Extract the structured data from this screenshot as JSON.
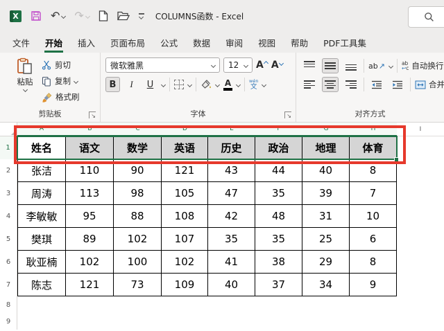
{
  "titlebar": {
    "title": "COLUMNS函数 - Excel"
  },
  "icons": {
    "excel_logo": "X",
    "undo": "↶",
    "redo": "↷",
    "launcher": "↘",
    "grow_font": "A",
    "shrink_font": "A",
    "bold": "B",
    "italic": "I",
    "underline": "U",
    "font_color": "A",
    "phonetic_top": "wén",
    "phonetic_bottom": "文",
    "orientation_ab": "ab",
    "orientation_arrow": "↗",
    "wrap_ab": "ab",
    "wrap_c": "c",
    "wrap_arrow": "↩"
  },
  "tabs": [
    {
      "name": "file",
      "label": "文件",
      "active": false
    },
    {
      "name": "home",
      "label": "开始",
      "active": true
    },
    {
      "name": "insert",
      "label": "插入",
      "active": false
    },
    {
      "name": "page-layout",
      "label": "页面布局",
      "active": false
    },
    {
      "name": "formulas",
      "label": "公式",
      "active": false
    },
    {
      "name": "data",
      "label": "数据",
      "active": false
    },
    {
      "name": "review",
      "label": "审阅",
      "active": false
    },
    {
      "name": "view",
      "label": "视图",
      "active": false
    },
    {
      "name": "help",
      "label": "帮助",
      "active": false
    },
    {
      "name": "pdf-tools",
      "label": "PDF工具集",
      "active": false
    }
  ],
  "ribbon": {
    "clipboard": {
      "label": "剪贴板",
      "paste": "粘贴",
      "cut": "剪切",
      "copy": "复制",
      "format_painter": "格式刷"
    },
    "font": {
      "label": "字体",
      "font_name": "微软雅黑",
      "font_size": "12"
    },
    "alignment": {
      "label": "对齐方式",
      "wrap_text": "自动换行",
      "merge_center": "合并后居中"
    }
  },
  "grid": {
    "columns": [
      "A",
      "B",
      "C",
      "D",
      "E",
      "F",
      "G",
      "H",
      "I"
    ],
    "rows": [
      "1",
      "2",
      "3",
      "4",
      "5",
      "6",
      "7",
      "8",
      "9"
    ],
    "table": {
      "headers": [
        "姓名",
        "语文",
        "数学",
        "英语",
        "历史",
        "政治",
        "地理",
        "体育"
      ],
      "rows": [
        [
          "张洁",
          "110",
          "90",
          "121",
          "43",
          "44",
          "40",
          "8"
        ],
        [
          "周涛",
          "113",
          "98",
          "105",
          "47",
          "35",
          "39",
          "7"
        ],
        [
          "李敏敏",
          "95",
          "88",
          "108",
          "42",
          "48",
          "31",
          "10"
        ],
        [
          "樊琪",
          "89",
          "102",
          "107",
          "35",
          "35",
          "25",
          "6"
        ],
        [
          "耿亚楠",
          "102",
          "100",
          "102",
          "41",
          "38",
          "29",
          "8"
        ],
        [
          "陈志",
          "121",
          "73",
          "109",
          "40",
          "37",
          "34",
          "9"
        ]
      ]
    }
  },
  "colors": {
    "accent_green": "#1E7145",
    "annotation_red": "#E6392C",
    "selected_header_fill": "#D5D5D5"
  }
}
